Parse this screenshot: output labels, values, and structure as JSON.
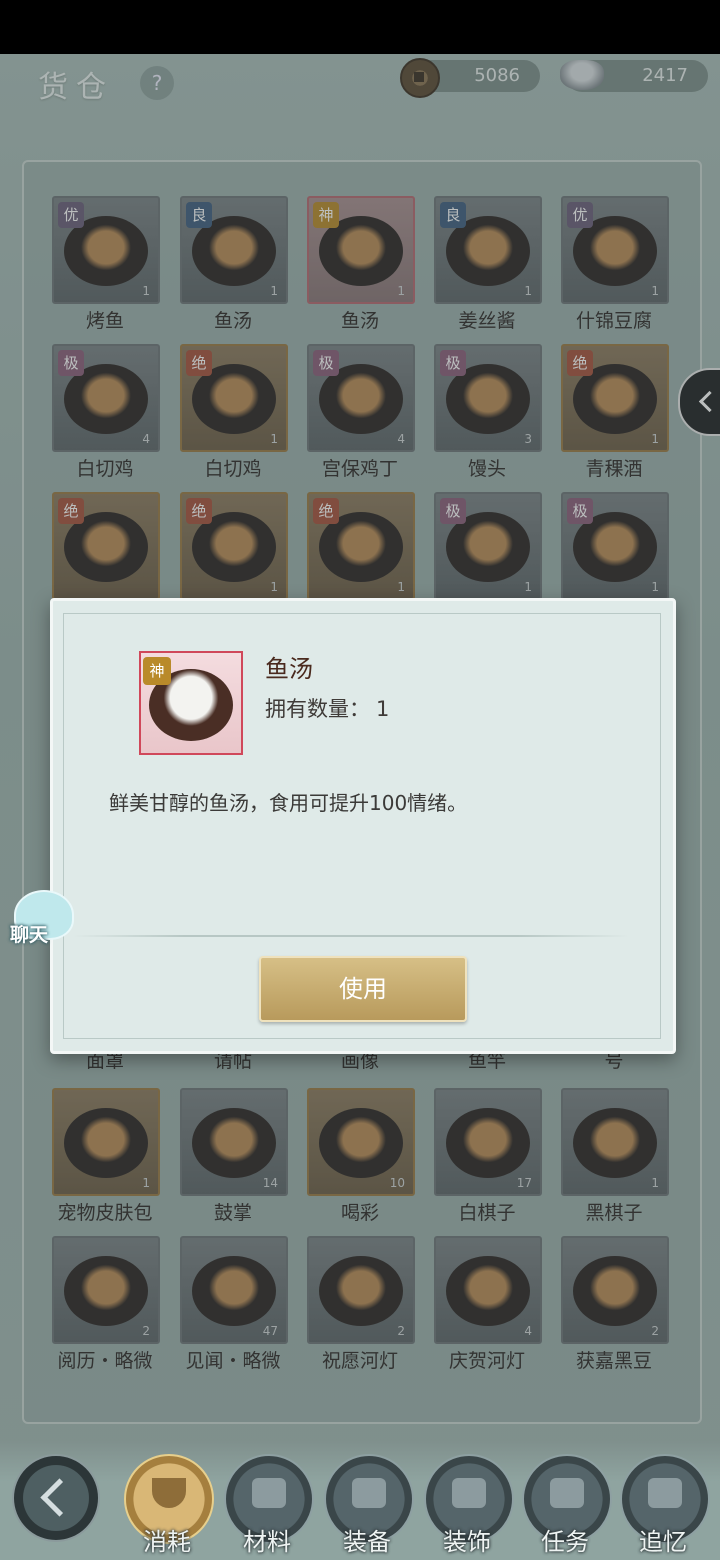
{
  "header": {
    "title": "货仓",
    "help": "?",
    "copper": "5086",
    "silver": "2417"
  },
  "items": [
    {
      "name": "烤鱼",
      "badge": "优",
      "badge_class": "you",
      "qty": "1",
      "frame": ""
    },
    {
      "name": "鱼汤",
      "badge": "良",
      "badge_class": "liang",
      "qty": "1",
      "frame": ""
    },
    {
      "name": "鱼汤",
      "badge": "神",
      "badge_class": "shen",
      "qty": "1",
      "frame": "red"
    },
    {
      "name": "姜丝酱",
      "badge": "良",
      "badge_class": "liang",
      "qty": "1",
      "frame": ""
    },
    {
      "name": "什锦豆腐",
      "badge": "优",
      "badge_class": "you",
      "qty": "1",
      "frame": ""
    },
    {
      "name": "白切鸡",
      "badge": "极",
      "badge_class": "ji",
      "qty": "4",
      "frame": ""
    },
    {
      "name": "白切鸡",
      "badge": "绝",
      "badge_class": "jue",
      "qty": "1",
      "frame": "gold"
    },
    {
      "name": "宫保鸡丁",
      "badge": "极",
      "badge_class": "ji",
      "qty": "4",
      "frame": ""
    },
    {
      "name": "馒头",
      "badge": "极",
      "badge_class": "ji",
      "qty": "3",
      "frame": ""
    },
    {
      "name": "青稞酒",
      "badge": "绝",
      "badge_class": "jue",
      "qty": "1",
      "frame": "gold"
    },
    {
      "name": "",
      "badge": "绝",
      "badge_class": "jue",
      "qty": "",
      "frame": "gold"
    },
    {
      "name": "",
      "badge": "绝",
      "badge_class": "jue",
      "qty": "1",
      "frame": "gold"
    },
    {
      "name": "",
      "badge": "绝",
      "badge_class": "jue",
      "qty": "1",
      "frame": "gold"
    },
    {
      "name": "",
      "badge": "极",
      "badge_class": "ji",
      "qty": "1",
      "frame": ""
    },
    {
      "name": "",
      "badge": "极",
      "badge_class": "ji",
      "qty": "1",
      "frame": ""
    }
  ],
  "partial_row_labels": [
    "面罩",
    "请帖",
    "画像",
    "鱼竿",
    "号"
  ],
  "items_lower": [
    {
      "name": "宠物皮肤包",
      "qty": "1",
      "frame": "gold"
    },
    {
      "name": "鼓掌",
      "qty": "14",
      "frame": ""
    },
    {
      "name": "喝彩",
      "qty": "10",
      "frame": "gold"
    },
    {
      "name": "白棋子",
      "qty": "17",
      "frame": ""
    },
    {
      "name": "黑棋子",
      "qty": "1",
      "frame": ""
    },
    {
      "name": "阅历・略微",
      "qty": "2",
      "frame": ""
    },
    {
      "name": "见闻・略微",
      "qty": "47",
      "frame": ""
    },
    {
      "name": "祝愿河灯",
      "qty": "2",
      "frame": ""
    },
    {
      "name": "庆贺河灯",
      "qty": "4",
      "frame": ""
    },
    {
      "name": "获嘉黑豆",
      "qty": "2",
      "frame": ""
    }
  ],
  "modal": {
    "badge": "神",
    "title": "鱼汤",
    "count_label": "拥有数量：",
    "count_value": "1",
    "description": "鲜美甘醇的鱼汤，食用可提升100情绪。",
    "use_label": "使用"
  },
  "chat": {
    "label": "聊天"
  },
  "tabs": [
    {
      "label": "消耗",
      "active": true
    },
    {
      "label": "材料",
      "active": false
    },
    {
      "label": "装备",
      "active": false
    },
    {
      "label": "装饰",
      "active": false
    },
    {
      "label": "任务",
      "active": false
    },
    {
      "label": "追忆",
      "active": false
    }
  ]
}
